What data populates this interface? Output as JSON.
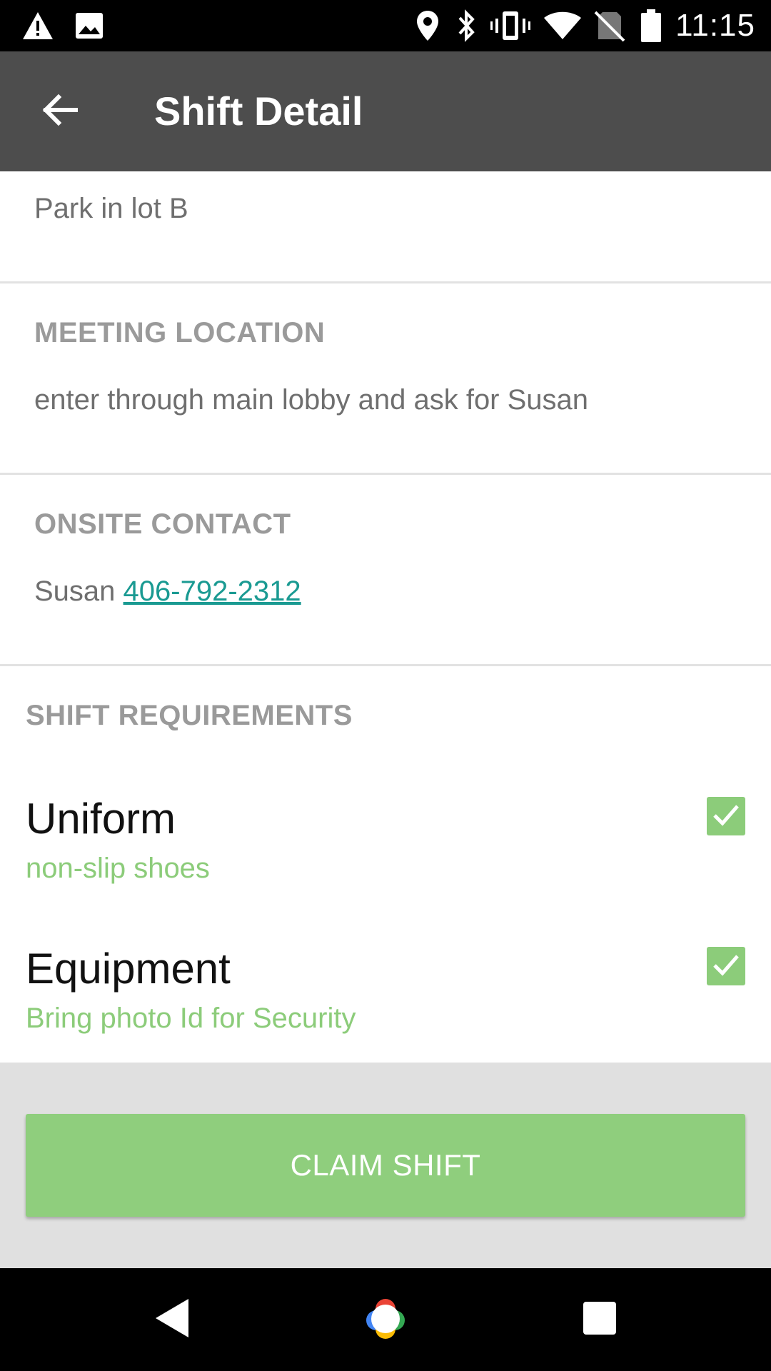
{
  "status_bar": {
    "time": "11:15",
    "icons": [
      "warning-icon",
      "image-icon",
      "location-icon",
      "bluetooth-icon",
      "vibrate-icon",
      "wifi-icon",
      "no-sim-icon",
      "battery-icon"
    ]
  },
  "app_bar": {
    "title": "Shift Detail",
    "back_icon": "arrow-back-icon"
  },
  "parking": {
    "text": "Park in lot B"
  },
  "meeting_location": {
    "heading": "MEETING LOCATION",
    "text": "enter through main lobby and ask for Susan"
  },
  "onsite_contact": {
    "heading": "ONSITE CONTACT",
    "name": "Susan",
    "phone": "406-792-2312"
  },
  "shift_requirements": {
    "heading": "SHIFT REQUIREMENTS",
    "items": [
      {
        "title": "Uniform",
        "detail": "non-slip shoes",
        "checked": true
      },
      {
        "title": "Equipment",
        "detail": "Bring photo Id for Security",
        "checked": true
      }
    ]
  },
  "actions": {
    "claim_label": "CLAIM SHIFT"
  },
  "colors": {
    "accent_green": "#8fce7d",
    "link_teal": "#1a9a92",
    "app_bar": "#4d4d4d"
  },
  "nav_bar": {
    "icons": [
      "back-triangle-icon",
      "home-assistant-icon",
      "recents-square-icon"
    ]
  }
}
